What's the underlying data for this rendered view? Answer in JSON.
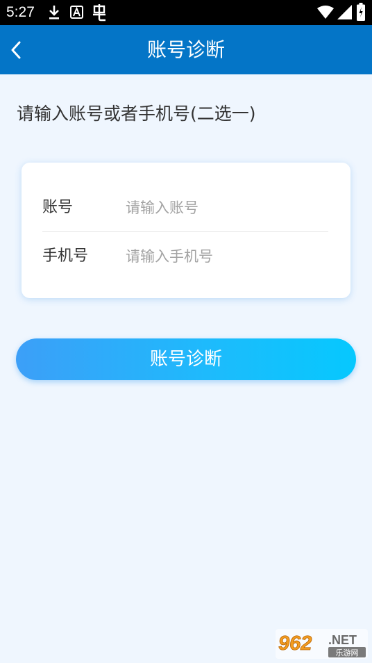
{
  "status_bar": {
    "time": "5:27",
    "left_icons": [
      "download-icon",
      "app-a-icon",
      "bug-icon"
    ],
    "right_icons": [
      "wifi-icon",
      "signal-icon",
      "battery-charging-icon"
    ]
  },
  "header": {
    "title": "账号诊断",
    "back_icon": "chevron-left-icon",
    "background": "#0475c7"
  },
  "instruction": "请输入账号或者手机号(二选一)",
  "form": {
    "account_label": "账号",
    "account_placeholder": "请输入账号",
    "account_value": "",
    "phone_label": "手机号",
    "phone_placeholder": "请输入手机号",
    "phone_value": ""
  },
  "diagnose_button_label": "账号诊断",
  "watermark": {
    "brand": "962",
    "suffix": ".NET",
    "sub_label": "乐游网"
  },
  "colors": {
    "page_background": "#eff6fe",
    "button_gradient_start": "#3c9ff8",
    "button_gradient_end": "#06c8fe"
  }
}
